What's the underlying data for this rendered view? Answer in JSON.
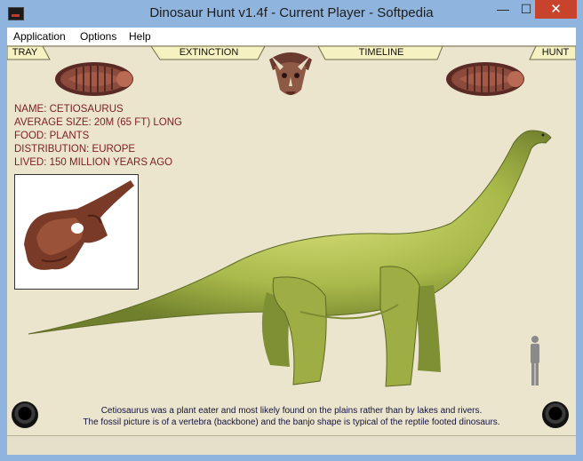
{
  "window": {
    "title": "Dinosaur Hunt v1.4f - Current Player - Softpedia",
    "minimize_glyph": "—",
    "maximize_glyph": "☐",
    "close_glyph": "✕"
  },
  "menu": {
    "items": [
      "Application",
      "Options",
      "Help"
    ]
  },
  "tabs": {
    "tray": "TRAY",
    "extinction": "EXTINCTION",
    "timeline": "TIMELINE",
    "hunt": "HUNT"
  },
  "dinosaur": {
    "name": "NAME: CETIOSAURUS",
    "size": "AVERAGE SIZE: 20M (65 FT) LONG",
    "food": "FOOD: PLANTS",
    "distribution": "DISTRIBUTION: EUROPE",
    "lived": "LIVED: 150 MILLION YEARS AGO"
  },
  "caption": {
    "line1": "Cetiosaurus was a plant eater and most likely found on the plains rather than by lakes and rivers.",
    "line2": "The fossil picture is of a vertebra (backbone) and the banjo shape is typical of the reptile footed dinosaurs."
  },
  "colors": {
    "info_text": "#7a1f1f",
    "caption_text": "#12123d",
    "tab_fill": "#f6f1c0",
    "content_bg": "#ece5ce",
    "close_button": "#c7432c"
  },
  "icons": [
    "app-icon",
    "trilobite-icon",
    "triceratops-skull-icon",
    "speaker-icon",
    "human-scale-icon"
  ]
}
